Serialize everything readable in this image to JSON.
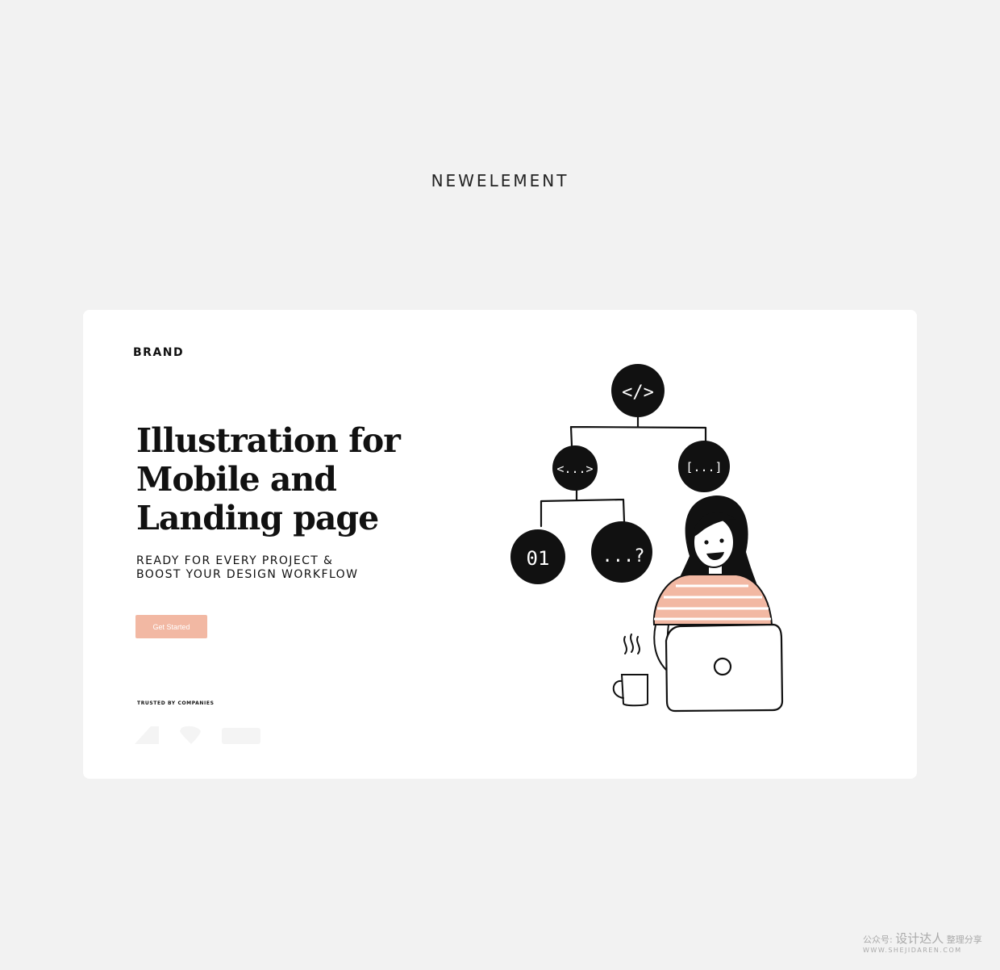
{
  "studio_logo": "NEWELEMENT",
  "card": {
    "brand": "BRAND",
    "headline": [
      "Illustration for",
      "Mobile and",
      "Landing page"
    ],
    "subtitle": [
      "READY FOR EVERY PROJECT &",
      "BOOST YOUR DESIGN WORKFLOW"
    ],
    "cta_label": "Get Started",
    "trusted_label": "TRUSTED BY COMPANIES",
    "illustration": {
      "nodes": [
        "</>",
        "<...>",
        "[...]",
        "01",
        "...?"
      ]
    }
  },
  "watermark": {
    "prefix": "公众号:",
    "name": "设计达人",
    "suffix": "整理分享",
    "url": "WWW.SHEJIDAREN.COM"
  },
  "colors": {
    "background": "#f2f2f2",
    "card": "#ffffff",
    "accent": "#f2b8a3",
    "text": "#111111"
  }
}
